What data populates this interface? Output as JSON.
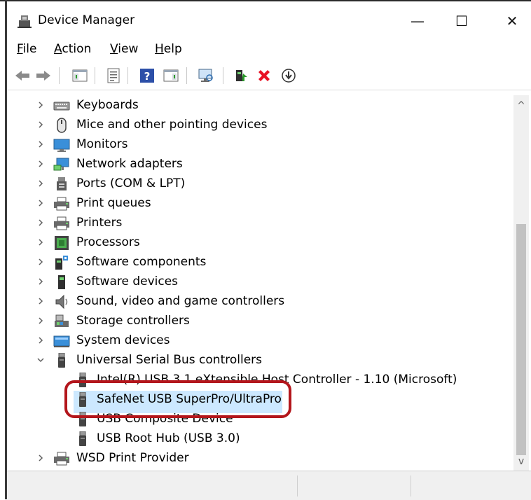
{
  "window": {
    "title": "Device Manager",
    "controls": {
      "minimize": "—",
      "maximize": "☐",
      "close": "✕"
    }
  },
  "menu": [
    {
      "accel": "F",
      "rest": "ile"
    },
    {
      "accel": "A",
      "rest": "ction"
    },
    {
      "accel": "V",
      "rest": "iew"
    },
    {
      "accel": "H",
      "rest": "elp"
    }
  ],
  "toolbar_icons": [
    "back-arrow-icon",
    "forward-arrow-icon",
    "show-hide-console-tree-icon",
    "properties-icon",
    "help-icon",
    "show-hide-action-pane-icon",
    "monitor-scan-icon",
    "update-driver-icon",
    "uninstall-device-icon",
    "rollback-driver-icon"
  ],
  "colors": {
    "selection": "#cce8ff",
    "highlight": "#b3161c",
    "uninstall": "#e81123"
  },
  "tree": [
    {
      "label": "Keyboards",
      "icon": "keyboard-icon",
      "state": "collapsed"
    },
    {
      "label": "Mice and other pointing devices",
      "icon": "mouse-icon",
      "state": "collapsed"
    },
    {
      "label": "Monitors",
      "icon": "monitor-icon",
      "state": "collapsed"
    },
    {
      "label": "Network adapters",
      "icon": "network-adapter-icon",
      "state": "collapsed"
    },
    {
      "label": "Ports (COM & LPT)",
      "icon": "port-icon",
      "state": "collapsed"
    },
    {
      "label": "Print queues",
      "icon": "printer-icon",
      "state": "collapsed"
    },
    {
      "label": "Printers",
      "icon": "printer-icon",
      "state": "collapsed"
    },
    {
      "label": "Processors",
      "icon": "processor-icon",
      "state": "collapsed"
    },
    {
      "label": "Software components",
      "icon": "software-component-icon",
      "state": "collapsed"
    },
    {
      "label": "Software devices",
      "icon": "software-device-icon",
      "state": "collapsed"
    },
    {
      "label": "Sound, video and game controllers",
      "icon": "speaker-icon",
      "state": "collapsed"
    },
    {
      "label": "Storage controllers",
      "icon": "storage-controller-icon",
      "state": "collapsed"
    },
    {
      "label": "System devices",
      "icon": "system-devices-icon",
      "state": "collapsed"
    },
    {
      "label": "Universal Serial Bus controllers",
      "icon": "usb-icon",
      "state": "expanded"
    },
    {
      "label": "Intel(R) USB 3.1 eXtensible Host Controller - 1.10 (Microsoft)",
      "icon": "usb-icon",
      "state": "child"
    },
    {
      "label": "SafeNet USB SuperPro/UltraPro",
      "icon": "usb-icon",
      "state": "child-selected"
    },
    {
      "label": "USB Composite Device",
      "icon": "usb-icon",
      "state": "child"
    },
    {
      "label": "USB Root Hub (USB 3.0)",
      "icon": "usb-icon",
      "state": "child"
    },
    {
      "label": "WSD Print Provider",
      "icon": "printer-icon",
      "state": "collapsed"
    }
  ],
  "scrollbar": {
    "up": "^",
    "down": "v"
  }
}
